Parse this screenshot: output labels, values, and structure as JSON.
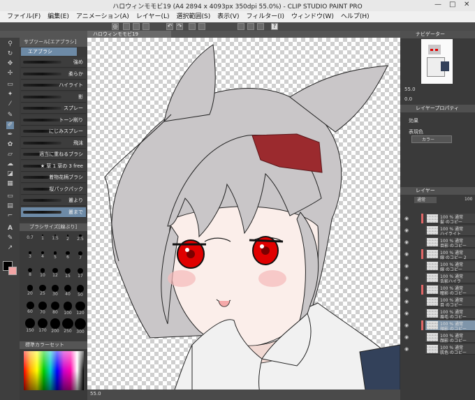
{
  "window": {
    "title": "ハロウィンモモビ19 (A4 2894 x 4093px 350dpi 55.0%) - CLIP STUDIO PAINT PRO",
    "controls": [
      "—",
      "□",
      "✕"
    ]
  },
  "menu": [
    "ファイル(F)",
    "編集(E)",
    "アニメーション(A)",
    "レイヤー(L)",
    "選択範囲(S)",
    "表示(V)",
    "フィルター(I)",
    "ウィンドウ(W)",
    "ヘルプ(H)"
  ],
  "canvas_tab": "ハロウィンモモビ19",
  "subtool": {
    "header": "サブツール[エアブラシ]",
    "group": "エアブラシ",
    "brushes": [
      "強め",
      "柔らか",
      "ハイライト",
      "影",
      "スプレー",
      "トーン削り",
      "にじみスプレー",
      "飛沫",
      "適当に重ねるブラシ",
      "★ 草 1 草の 3 free",
      "着物花柄ブラシ",
      "桜パックパック",
      "叢より",
      "叢まで"
    ]
  },
  "brush_size": {
    "header": "ブラシサイズ[線ぶり]",
    "sizes": [
      "0.7",
      "1",
      "1.5",
      "2",
      "2.5",
      "3",
      "4",
      "5",
      "6",
      "7",
      "8",
      "10",
      "12",
      "15",
      "17",
      "20",
      "25",
      "30",
      "40",
      "50",
      "60",
      "70",
      "80",
      "100",
      "120",
      "150",
      "170",
      "200",
      "250",
      "300"
    ]
  },
  "color_set": {
    "header": "標準カラーセット"
  },
  "navigator": {
    "header": "ナビゲーター",
    "zoom": "55.0",
    "angle": "0.0"
  },
  "layer_property": {
    "header": "レイヤープロパティ",
    "effect_label": "効果",
    "expression_label": "表現色",
    "expression_value": "カラー"
  },
  "layers_panel": {
    "header": "レイヤー",
    "blend": "通常",
    "opacity": "100",
    "items": [
      {
        "name": "100 % 通常",
        "sub": "髪 のコピー"
      },
      {
        "name": "100 % 通常",
        "sub": "ハイライト"
      },
      {
        "name": "100 % 通常",
        "sub": "目影 のコピー"
      },
      {
        "name": "100 % 通常",
        "sub": "線 のコピー 2"
      },
      {
        "name": "100 % 通常",
        "sub": "線 のコピー"
      },
      {
        "name": "100 % 通常",
        "sub": "舌影ハイラ"
      },
      {
        "name": "100 % 通常",
        "sub": "瞳影 のコピー"
      },
      {
        "name": "100 % 通常",
        "sub": "目 のコピー"
      },
      {
        "name": "100 % 通常",
        "sub": "眉毛 のコピー"
      },
      {
        "name": "100 % 通常",
        "sub": "頬影 のコピー"
      },
      {
        "name": "100 % 通常",
        "sub": "顔影 のコピー"
      },
      {
        "name": "100 % 通常",
        "sub": "肌色 のコピー"
      }
    ]
  },
  "status": {
    "zoom": "55.0"
  },
  "colors": {
    "hair_clip": "#9b2a2e",
    "eye": "#e00000",
    "hair": "#c9c6c8",
    "skin": "#fbeeea",
    "selection_blue": "#7f95aa"
  }
}
